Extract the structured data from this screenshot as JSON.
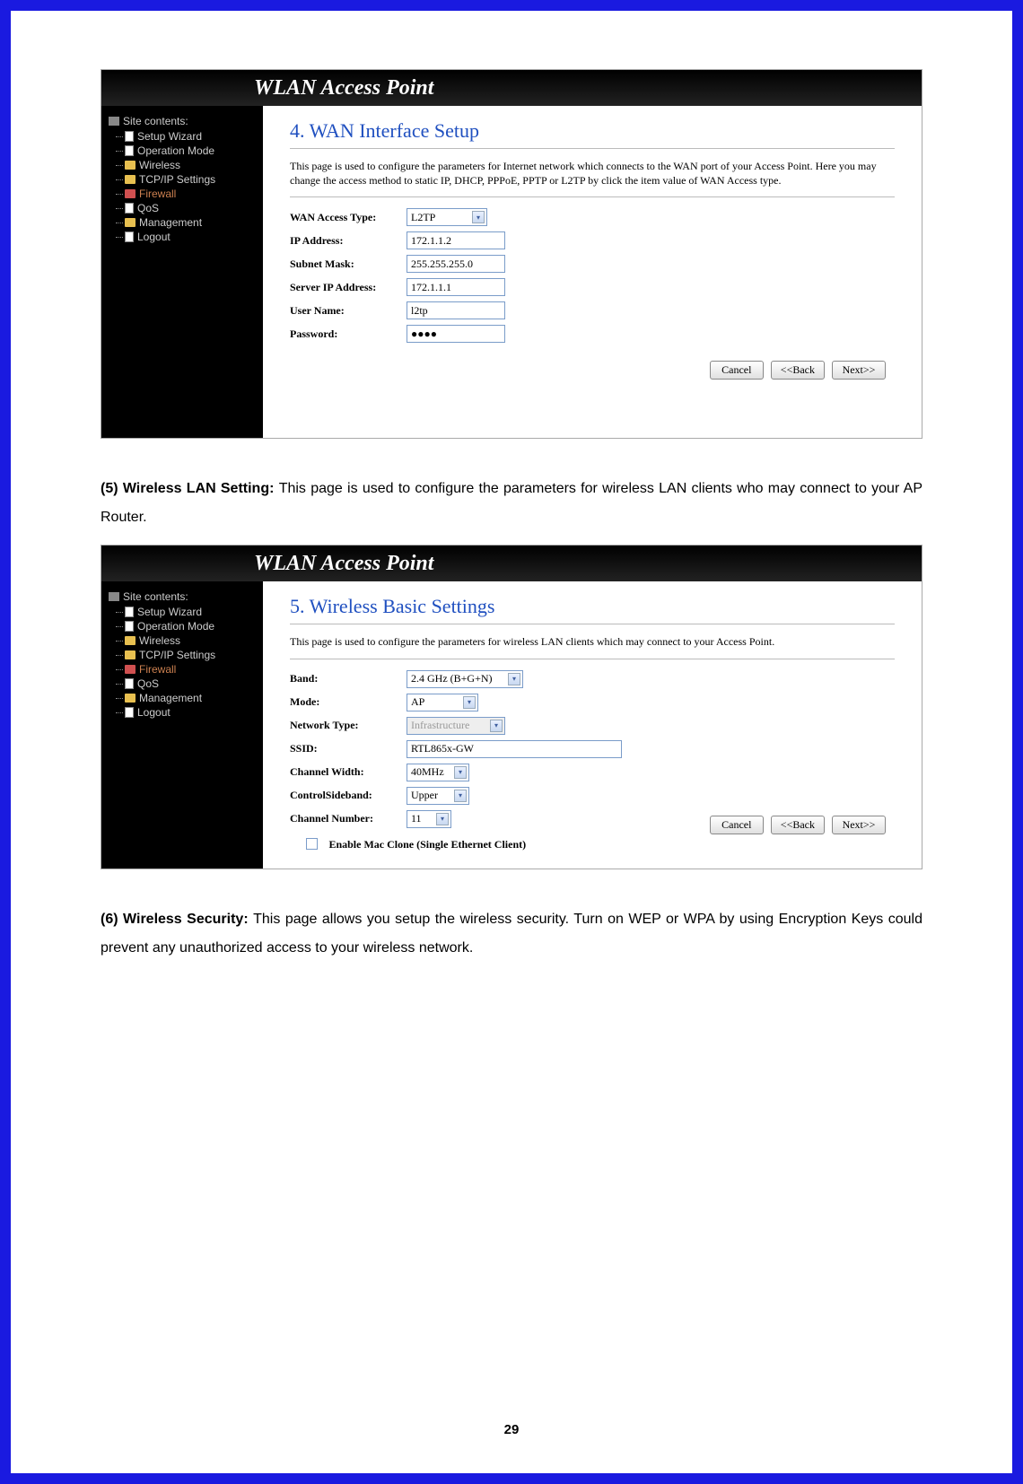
{
  "app_title": "WLAN Access Point",
  "sidebar": {
    "root": "Site contents:",
    "items": [
      {
        "label": "Setup Wizard",
        "icon": "page"
      },
      {
        "label": "Operation Mode",
        "icon": "page"
      },
      {
        "label": "Wireless",
        "icon": "folder"
      },
      {
        "label": "TCP/IP Settings",
        "icon": "folder"
      },
      {
        "label": "Firewall",
        "icon": "folder-open",
        "highlight": true
      },
      {
        "label": "QoS",
        "icon": "page"
      },
      {
        "label": "Management",
        "icon": "folder"
      },
      {
        "label": "Logout",
        "icon": "page"
      }
    ]
  },
  "screenshot1": {
    "heading": "4. WAN Interface Setup",
    "description": "This page is used to configure the parameters for Internet network which connects to the WAN port of your Access Point. Here you may change the access method to static IP, DHCP, PPPoE, PPTP or L2TP by click the item value of WAN Access type.",
    "fields": {
      "wan_access_type": {
        "label": "WAN Access Type:",
        "value": "L2TP"
      },
      "ip_address": {
        "label": "IP Address:",
        "value": "172.1.1.2"
      },
      "subnet_mask": {
        "label": "Subnet Mask:",
        "value": "255.255.255.0"
      },
      "server_ip": {
        "label": "Server IP Address:",
        "value": "172.1.1.1"
      },
      "user_name": {
        "label": "User Name:",
        "value": "l2tp"
      },
      "password": {
        "label": "Password:",
        "value": "●●●●"
      }
    },
    "buttons": {
      "cancel": "Cancel",
      "back": "<<Back",
      "next": "Next>>"
    }
  },
  "paragraph1": {
    "bold": "(5) Wireless LAN Setting: ",
    "text": "This page is used to configure the parameters for wireless LAN clients who may connect to your AP Router."
  },
  "screenshot2": {
    "heading": "5. Wireless Basic Settings",
    "description": "This page is used to configure the parameters for wireless LAN clients which may connect to your Access Point.",
    "fields": {
      "band": {
        "label": "Band:",
        "value": "2.4 GHz (B+G+N)"
      },
      "mode": {
        "label": "Mode:",
        "value": "AP"
      },
      "network_type": {
        "label": "Network Type:",
        "value": "Infrastructure"
      },
      "ssid": {
        "label": "SSID:",
        "value": "RTL865x-GW"
      },
      "channel_width": {
        "label": "Channel Width:",
        "value": "40MHz"
      },
      "control_sideband": {
        "label": "ControlSideband:",
        "value": "Upper"
      },
      "channel_number": {
        "label": "Channel Number:",
        "value": "11"
      },
      "mac_clone": {
        "label": "Enable Mac Clone (Single Ethernet Client)"
      }
    },
    "buttons": {
      "cancel": "Cancel",
      "back": "<<Back",
      "next": "Next>>"
    }
  },
  "paragraph2": {
    "bold": "(6) Wireless Security: ",
    "text": "This page allows you setup the wireless security. Turn on WEP or WPA by using Encryption Keys could prevent any unauthorized access to your wireless network."
  },
  "page_number": "29"
}
